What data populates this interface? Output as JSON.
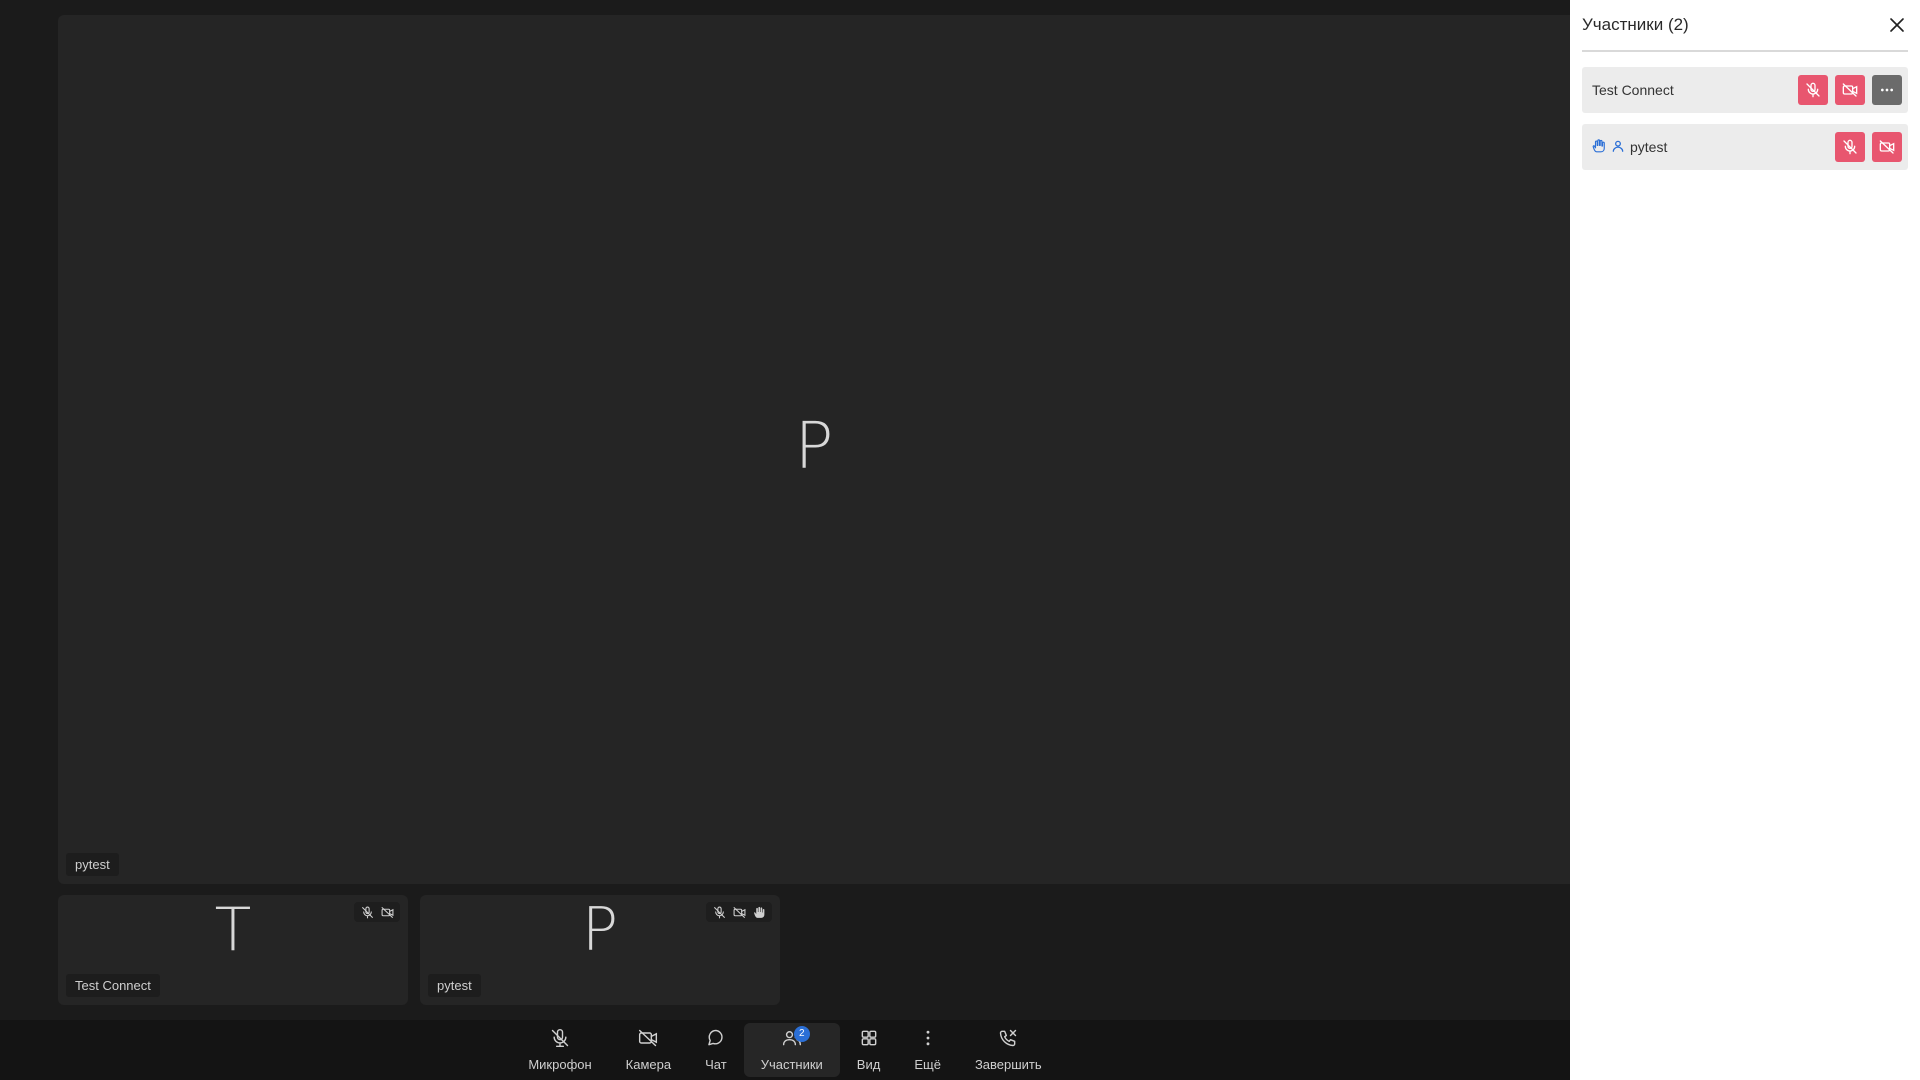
{
  "colors": {
    "accent_blue": "#2b6fd6",
    "danger_red": "#e8566f",
    "tile_bg": "#252525",
    "panel_bg": "#ffffff"
  },
  "stage": {
    "main_tile": {
      "avatar_letter": "P",
      "name": "pytest"
    },
    "thumbs": [
      {
        "avatar_letter": "T",
        "name": "Test Connect",
        "status_icons": [
          "mic-off-icon",
          "camera-off-icon"
        ]
      },
      {
        "avatar_letter": "P",
        "name": "pytest",
        "status_icons": [
          "mic-off-icon",
          "camera-off-icon",
          "raised-hand-icon"
        ]
      }
    ]
  },
  "toolbar": {
    "mic_label": "Микрофон",
    "camera_label": "Камера",
    "chat_label": "Чат",
    "participants_label": "Участники",
    "participants_badge": "2",
    "view_label": "Вид",
    "more_label": "Ещё",
    "end_label": "Завершить"
  },
  "panel": {
    "title": "Участники (2)",
    "participants": [
      {
        "name": "Test Connect",
        "actions": [
          "mic-off-icon",
          "camera-off-icon",
          "more-horizontal-icon"
        ]
      },
      {
        "name": "pytest",
        "status_icons": [
          "raised-hand-icon",
          "user-icon"
        ],
        "actions": [
          "mic-off-icon",
          "camera-off-icon"
        ]
      }
    ]
  }
}
